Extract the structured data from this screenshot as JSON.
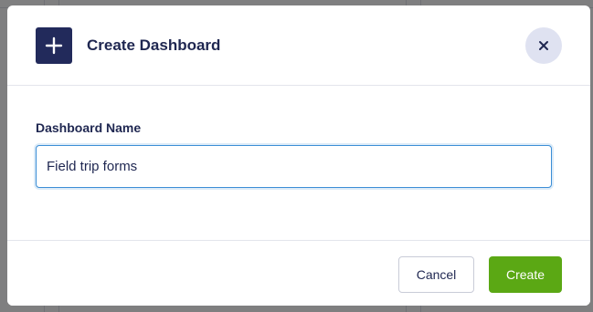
{
  "modal": {
    "title": "Create Dashboard",
    "header_icon": "plus-icon",
    "close_icon": "close-icon"
  },
  "form": {
    "label": "Dashboard Name",
    "value": "Field trip forms"
  },
  "footer": {
    "cancel_label": "Cancel",
    "create_label": "Create"
  },
  "colors": {
    "brand_navy": "#222a5b",
    "primary_green": "#5ba814",
    "focus_blue": "#3c8ed6"
  }
}
